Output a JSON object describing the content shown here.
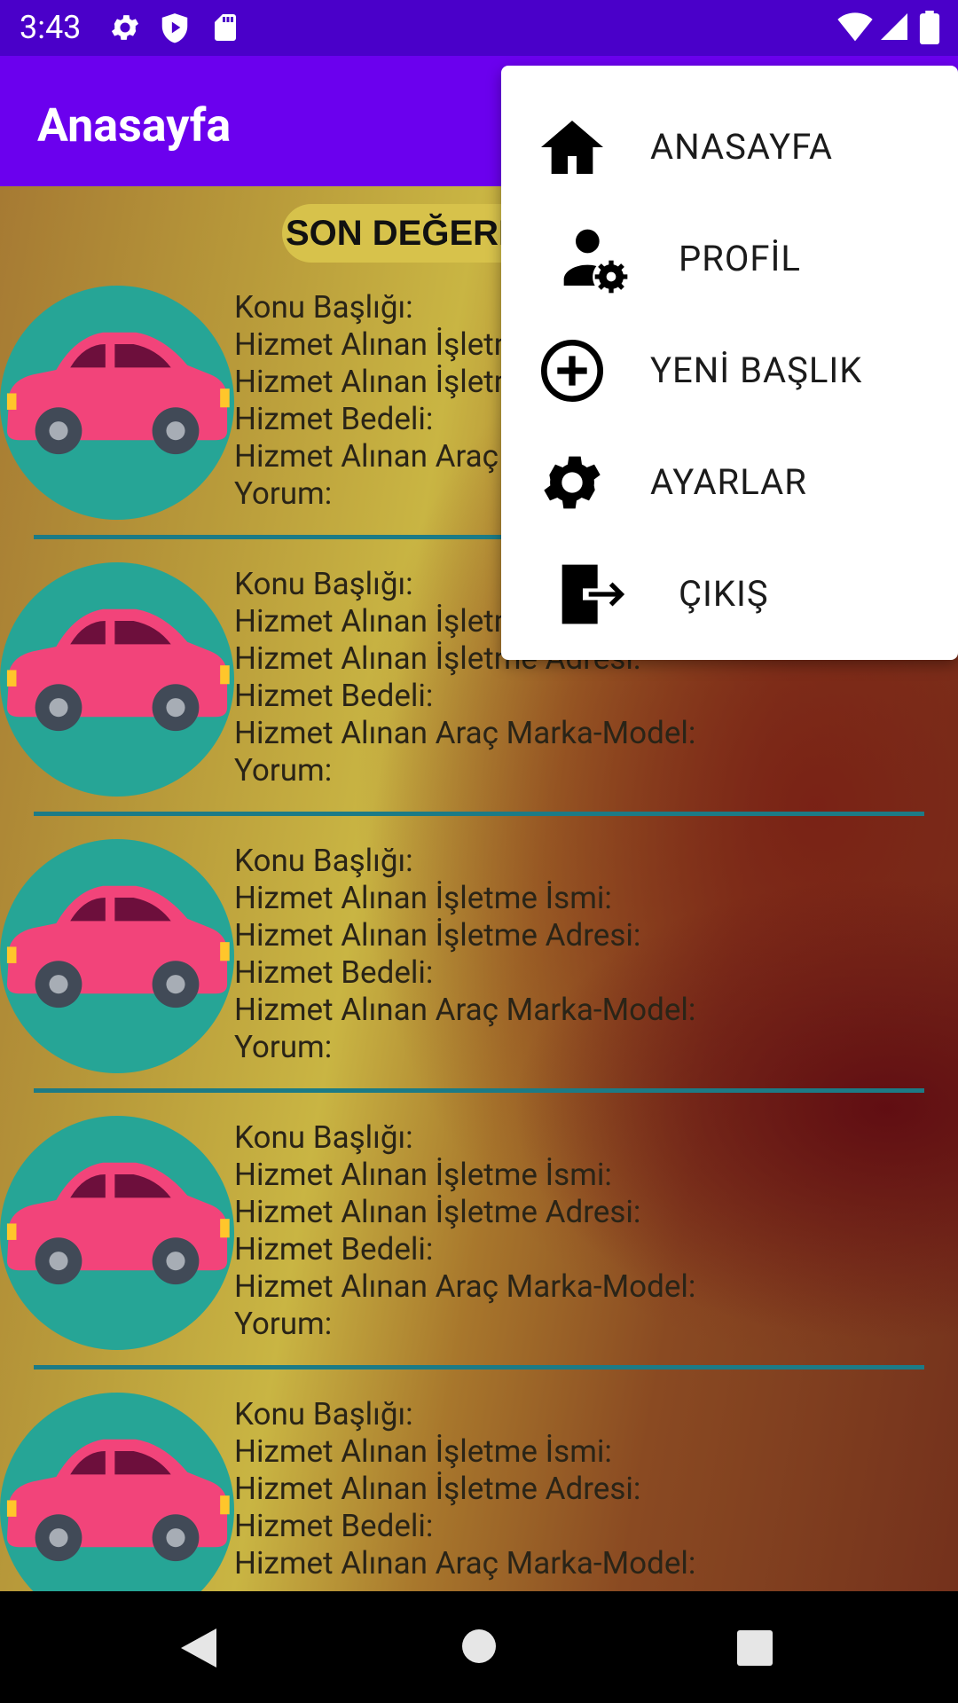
{
  "status_bar": {
    "time": "3:43"
  },
  "app_bar": {
    "title": "Anasayfa"
  },
  "content": {
    "header_pill": "SON DEĞERLENDİRMELER",
    "cards": [
      {
        "lines": [
          "Konu Başlığı:",
          "Hizmet Alınan İşletme İsmi:",
          "Hizmet Alınan İşletme Adresi:",
          "Hizmet Bedeli:",
          "Hizmet Alınan Araç Marka-Model:",
          "Yorum:"
        ]
      },
      {
        "lines": [
          "Konu Başlığı:",
          "Hizmet Alınan İşletme İsmi:",
          "Hizmet Alınan İşletme Adresi:",
          "Hizmet Bedeli:",
          "Hizmet Alınan Araç Marka-Model:",
          "Yorum:"
        ]
      },
      {
        "lines": [
          "Konu Başlığı:",
          "Hizmet Alınan İşletme İsmi:",
          "Hizmet Alınan İşletme Adresi:",
          "Hizmet Bedeli:",
          "Hizmet Alınan Araç Marka-Model:",
          "Yorum:"
        ]
      },
      {
        "lines": [
          "Konu Başlığı:",
          "Hizmet Alınan İşletme İsmi:",
          "Hizmet Alınan İşletme Adresi:",
          "Hizmet Bedeli:",
          "Hizmet Alınan Araç Marka-Model:",
          "Yorum:"
        ]
      },
      {
        "lines": [
          "Konu Başlığı:",
          "Hizmet Alınan İşletme İsmi:",
          "Hizmet Alınan İşletme Adresi:",
          "Hizmet Bedeli:",
          "Hizmet Alınan Araç Marka-Model:"
        ]
      }
    ]
  },
  "menu": {
    "items": [
      {
        "label": "ANASAYFA",
        "icon": "home-icon"
      },
      {
        "label": "PROFİL",
        "icon": "user-settings-icon"
      },
      {
        "label": "YENİ BAŞLIK",
        "icon": "add-circle-icon"
      },
      {
        "label": "AYARLAR",
        "icon": "gear-icon"
      },
      {
        "label": "ÇIKIŞ",
        "icon": "logout-icon"
      }
    ]
  },
  "colors": {
    "status_bar": "#4a00c9",
    "app_bar": "#6b00ee",
    "divider": "#1c7b86",
    "avatar_bg": "#26a596",
    "car_body": "#f2447a"
  }
}
